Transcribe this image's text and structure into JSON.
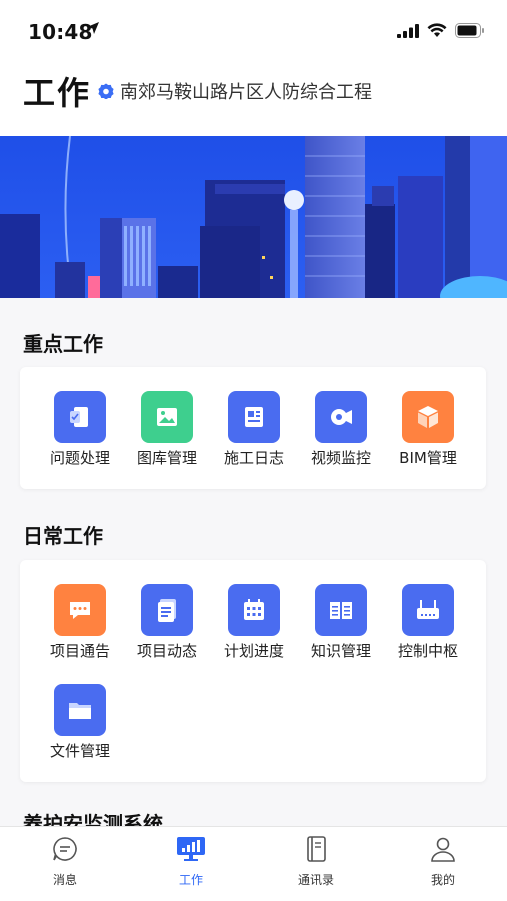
{
  "status_bar": {
    "time": "10:48"
  },
  "header": {
    "title": "工作",
    "project_name": "南郊马鞍山路片区人防综合工程"
  },
  "sections": [
    {
      "title": "重点工作",
      "items": [
        {
          "label": "问题处理",
          "icon": "issue-icon",
          "color": "#4a6cf0"
        },
        {
          "label": "图库管理",
          "icon": "image-gallery-icon",
          "color": "#3ecf8e"
        },
        {
          "label": "施工日志",
          "icon": "log-icon",
          "color": "#4a6cf0"
        },
        {
          "label": "视频监控",
          "icon": "video-camera-icon",
          "color": "#4a6cf0"
        },
        {
          "label": "BIM管理",
          "icon": "cube-icon",
          "color": "#ff8240"
        }
      ]
    },
    {
      "title": "日常工作",
      "items": [
        {
          "label": "项目通告",
          "icon": "notice-icon",
          "color": "#ff8240"
        },
        {
          "label": "项目动态",
          "icon": "document-icon",
          "color": "#4a6cf0"
        },
        {
          "label": "计划进度",
          "icon": "calendar-icon",
          "color": "#4a6cf0"
        },
        {
          "label": "知识管理",
          "icon": "book-icon",
          "color": "#4a6cf0"
        },
        {
          "label": "控制中枢",
          "icon": "router-icon",
          "color": "#4a6cf0"
        },
        {
          "label": "文件管理",
          "icon": "folder-icon",
          "color": "#4a6cf0"
        }
      ]
    },
    {
      "title": "养护安监测系统"
    }
  ],
  "tab_bar": {
    "items": [
      {
        "label": "消息",
        "icon": "message-icon",
        "active": false
      },
      {
        "label": "工作",
        "icon": "work-icon",
        "active": true
      },
      {
        "label": "通讯录",
        "icon": "contacts-icon",
        "active": false
      },
      {
        "label": "我的",
        "icon": "profile-icon",
        "active": false
      }
    ],
    "active_color": "#2e67f5"
  }
}
